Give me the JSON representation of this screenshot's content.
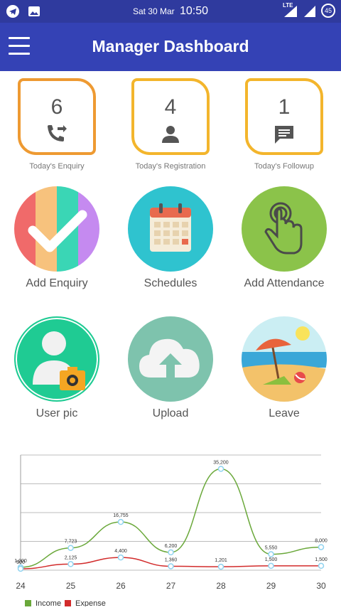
{
  "status_bar": {
    "date": "Sat 30 Mar",
    "time": "10:50",
    "network": "LTE",
    "battery": "45"
  },
  "app_bar": {
    "title": "Manager Dashboard"
  },
  "stats": [
    {
      "value": "6",
      "label": "Today's Enquiry",
      "icon": "phone-forward-icon",
      "border_color": "#ee9a32"
    },
    {
      "value": "4",
      "label": "Today's Registration",
      "icon": "person-icon",
      "border_color": "#f3b52c"
    },
    {
      "value": "1",
      "label": "Today's Followup",
      "icon": "message-icon",
      "border_color": "#f3b52c"
    }
  ],
  "tiles": [
    {
      "label": "Add Enquiry",
      "icon": "checkmark-icon"
    },
    {
      "label": "Schedules",
      "icon": "calendar-icon"
    },
    {
      "label": "Add Attendance",
      "icon": "hand-touch-icon"
    },
    {
      "label": "User pic",
      "icon": "user-camera-icon"
    },
    {
      "label": "Upload",
      "icon": "cloud-upload-icon"
    },
    {
      "label": "Leave",
      "icon": "beach-icon"
    }
  ],
  "chart_data": {
    "type": "line",
    "x": [
      24,
      25,
      26,
      27,
      28,
      29,
      30
    ],
    "series": [
      {
        "name": "Income",
        "color": "#6aa83a",
        "values": [
          1000,
          7723,
          16755,
          6200,
          35200,
          5550,
          8000
        ],
        "labels": [
          "1,000",
          "7,723",
          "16,755",
          "6,200",
          "35,200",
          "5,550",
          "8,000"
        ]
      },
      {
        "name": "Expense",
        "color": "#d22b2b",
        "values": [
          500,
          2125,
          4400,
          1360,
          1201,
          1500,
          1500
        ],
        "labels": [
          "500",
          "2,125",
          "4,400",
          "1,360",
          "1,201",
          "1,500",
          "1,500"
        ]
      }
    ],
    "ylim": [
      0,
      40000
    ],
    "grid": true,
    "legend": "bottom-left"
  }
}
